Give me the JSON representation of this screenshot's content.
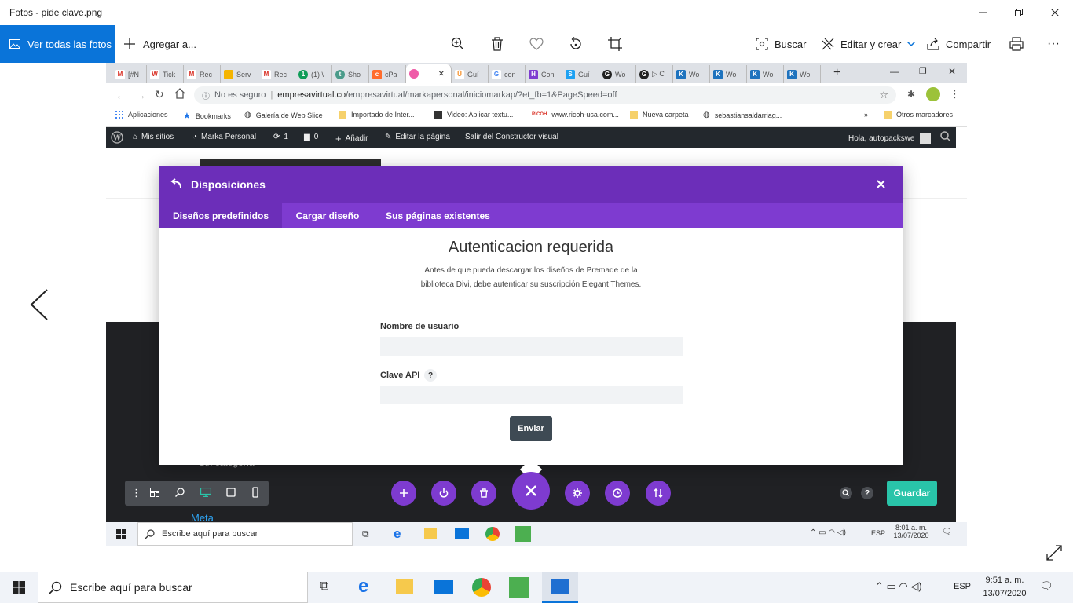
{
  "photos": {
    "title": "Fotos - pide clave.png",
    "view_all": "Ver todas las fotos",
    "add_to": "Agregar a...",
    "search": "Buscar",
    "edit_create": "Editar y crear",
    "share": "Compartir",
    "more": "···"
  },
  "browser": {
    "tabs": [
      "[#N",
      "Tick",
      "Rec",
      "Serv",
      "Rec",
      "(1) \\",
      "Sho",
      "cPa",
      "",
      "Guí",
      "con",
      "Con",
      "Guí",
      "Wo",
      "▷ C",
      "Wo",
      "Wo",
      "Wo",
      "Wo"
    ],
    "url_insecure": "No es seguro",
    "url_domain": "empresavirtual.co",
    "url_path": "/empresavirtual/markapersonal/iniciomarkap/?et_fb=1&PageSpeed=off",
    "bookmarks": [
      "Aplicaciones",
      "Bookmarks",
      "Galería de Web Slice",
      "Importado de Inter...",
      "Video: Aplicar textu...",
      "www.ricoh-usa.com...",
      "Nueva carpeta",
      "sebastiansaldarriag..."
    ],
    "other_bookmarks": "Otros marcadores",
    "chevrons": "»"
  },
  "wp": {
    "my_sites": "Mis sitios",
    "site": "Marka Personal",
    "updates": "1",
    "comments": "0",
    "add_new": "Añadir",
    "edit_page": "Editar la página",
    "exit_builder": "Salir del Constructor visual",
    "greeting": "Hola, autopackswe"
  },
  "modal": {
    "title": "Disposiciones",
    "tabs": [
      "Diseños predefinidos",
      "Cargar diseño",
      "Sus páginas existentes"
    ],
    "heading": "Autenticacion requerida",
    "description": "Antes de que pueda descargar los diseños de Premade de la biblioteca Divi, debe autenticar su suscripción Elegant Themes.",
    "username_label": "Nombre de usuario",
    "apikey_label": "Clave API",
    "help": "?",
    "submit": "Enviar"
  },
  "builder": {
    "save": "Guardar",
    "help": "?",
    "behind_text": "Meta",
    "behind_text_2": "Sin categoría"
  },
  "inner_taskbar": {
    "search": "Escribe aquí para buscar",
    "time": "8:01 a. m.",
    "date": "13/07/2020",
    "lang": "ESP",
    "notif": "2"
  },
  "taskbar": {
    "search": "Escribe aquí para buscar",
    "time": "9:51 a. m.",
    "date": "13/07/2020",
    "lang": "ESP",
    "notif": "2"
  },
  "colors": {
    "photos_accent": "#0a74d9",
    "divi_purple": "#7e3bd0",
    "divi_header": "#6c2eb9",
    "save_green": "#29c4a9",
    "wp_bar": "#23282d"
  }
}
